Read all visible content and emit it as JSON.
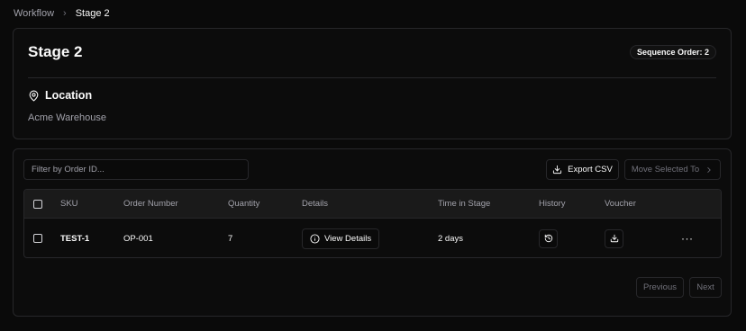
{
  "breadcrumb": {
    "parent": "Workflow",
    "separator": "›",
    "current": "Stage 2"
  },
  "stage": {
    "title": "Stage 2",
    "sequence_badge": "Sequence Order: 2",
    "location_title": "Location",
    "location_value": "Acme Warehouse"
  },
  "toolbar": {
    "filter_placeholder": "Filter by Order ID...",
    "export_label": "Export CSV",
    "move_label": "Move Selected To"
  },
  "table": {
    "headers": {
      "sku": "SKU",
      "order_number": "Order Number",
      "quantity": "Quantity",
      "details": "Details",
      "time_in_stage": "Time in Stage",
      "history": "History",
      "voucher": "Voucher"
    },
    "rows": [
      {
        "sku": "TEST-1",
        "order_number": "OP-001",
        "quantity": "7",
        "details_label": "View Details",
        "time_in_stage": "2 days",
        "more": "···"
      }
    ]
  },
  "pagination": {
    "previous": "Previous",
    "next": "Next"
  },
  "icons": {
    "location": "map-pin-icon",
    "export": "download-icon",
    "move": "chevron-right-icon",
    "details": "info-icon",
    "history": "history-icon",
    "voucher": "download-icon"
  }
}
